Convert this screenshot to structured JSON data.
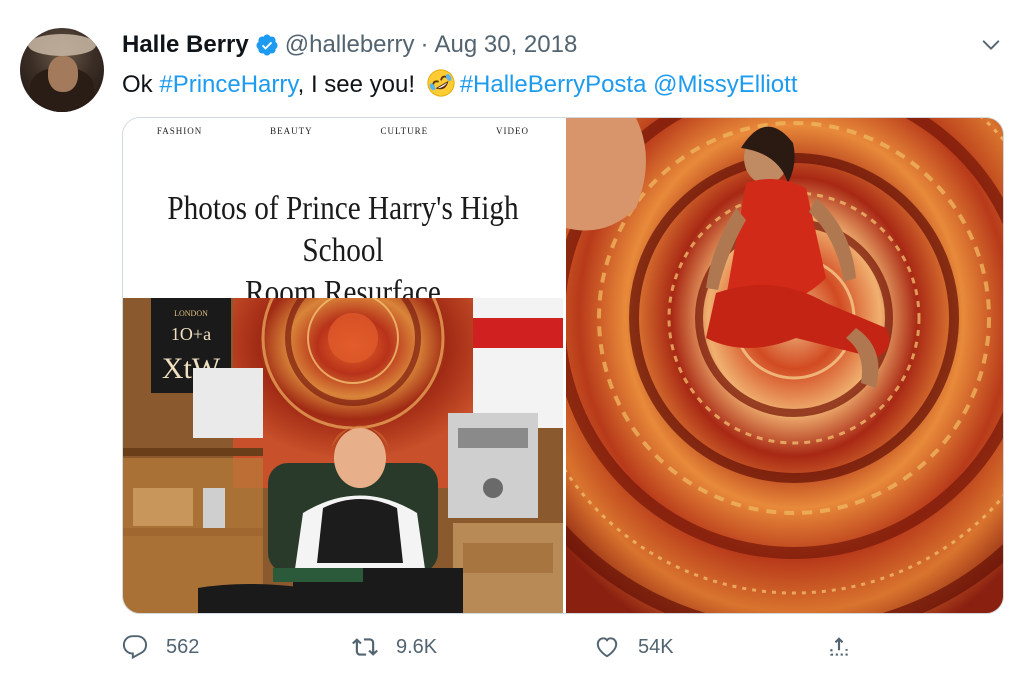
{
  "author": {
    "name": "Halle Berry",
    "handle": "@halleberry",
    "separator": "·",
    "date": "Aug 30, 2018",
    "verified": true,
    "avatar_icon": "avatar-icon"
  },
  "tweet": {
    "text_prefix": "Ok ",
    "hashtag1": "#PrinceHarry",
    "text_middle": ", I see you! ",
    "emoji": "rolling-on-floor-laughing-emoji",
    "hashtag2": "#HalleBerryPosta",
    "mention": "@MissyElliott"
  },
  "media": {
    "left_image": {
      "nav": [
        "FASHION",
        "BEAUTY",
        "CULTURE",
        "VIDEO"
      ],
      "headline_line1": "Photos of Prince Harry's High School",
      "headline_line2": "Room Resurface",
      "poster_text_top": "LONDON",
      "poster_text_mid": "1O+a",
      "poster_text_bot": "XtW"
    },
    "right_image": {
      "description_icon": "tapestry-photo"
    }
  },
  "actions": {
    "reply_count": "562",
    "retweet_count": "9.6K",
    "like_count": "54K"
  },
  "colors": {
    "link": "#1d9bf0",
    "secondary_text": "#536471",
    "verified": "#1d9bf0"
  }
}
